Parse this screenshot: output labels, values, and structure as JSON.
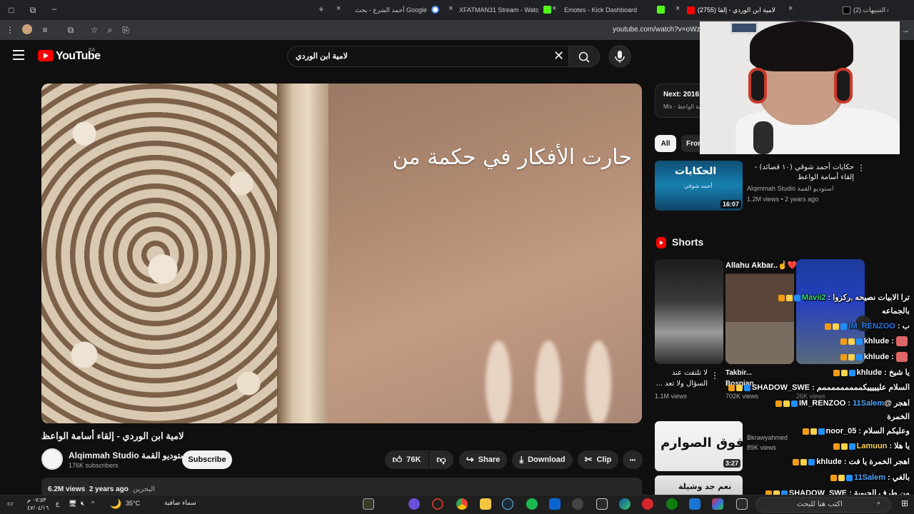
{
  "browser": {
    "tabs": [
      {
        "title": "(2) التنبيهات / X",
        "close": "×"
      },
      {
        "title": "(2755) لامية ابن الوردي - إلقا",
        "close": "×"
      },
      {
        "title": "Emotes - Kick Dashboard",
        "close": "×"
      },
      {
        "title": "XFATMAN31 Stream - Watch Li",
        "close": "×"
      },
      {
        "title": "أحمد الشرع - بحث Google",
        "close": "×"
      }
    ],
    "new_tab": "+",
    "url": "youtube.com/watch?v=oWzo"
  },
  "youtube": {
    "logo": "YouTube",
    "region": "SA",
    "search_value": "لامية ابن الوردي",
    "video": {
      "caption": "حارت الأفكار في حكمة من",
      "title": "لامية ابن الوردي - إلقاء أسامة الواعظ",
      "channel": "Alqimmah Studio استوديو القمة",
      "subscribers": "176K subscribers",
      "subscribe_label": "Subscribe",
      "likes": "76K",
      "share_label": "Share",
      "download_label": "Download",
      "clip_label": "Clip",
      "more_label": "•••",
      "views": "6.2M views",
      "age": "2 years ago",
      "location": "البحرين"
    },
    "upnext": {
      "label": "Next: 2016",
      "mix": "Mix - إلقاء أسامة الواعظ"
    },
    "chips": {
      "all": "All",
      "from": "From"
    },
    "rec1": {
      "thumb_title": "الحكايات",
      "thumb_sub": "أحمد شوقي",
      "duration": "16:07",
      "title": "حكايات أحمد شوقي (١٠ قصائد) - إلقاء أسامة الواعظ",
      "channel": "Alqimmah Studio استوديو القمة",
      "stats": "1.2M views • 2 years ago"
    },
    "shorts": {
      "label": "Shorts",
      "items": [
        {
          "title": "لا تلتفت عند السؤال ولا تعد ...",
          "views": "1.1M views"
        },
        {
          "overlay": "Allahu Akbar..☝️❤️",
          "title": "Takbir... Bosnian",
          "views": "702K views"
        },
        {
          "title": "",
          "views": "26K views"
        }
      ]
    },
    "rec2": {
      "thumb_title": "الهول فوق الصوارم",
      "duration": "3:27",
      "channel": "Bkrawyahmed",
      "views": "89K views"
    },
    "rec3": {
      "thumb_title": "نعم جد وشيلة"
    }
  },
  "chat": [
    {
      "user": "Mavii2",
      "color": "#3ddc84",
      "text": "ترا الابيات نصيحه ,ركزوا : "
    },
    {
      "user": "",
      "color": "#ffffff",
      "text": "بالجماعه"
    },
    {
      "user": "IM_RENZOO",
      "color": "#1f7ff0",
      "text": "ب : "
    },
    {
      "user": "khlude",
      "color": "#ffffff",
      "text": " : ",
      "emote": true
    },
    {
      "user": "khlude",
      "color": "#ffffff",
      "text": " : ",
      "emote": true
    },
    {
      "user": "khlude",
      "color": "#ffffff",
      "text": "يا شيخ : "
    },
    {
      "user": "SHADOW_SWE",
      "color": "#ffffff",
      "text": "السلام عليييييكمممممممممم : "
    },
    {
      "user": "11Salem",
      "color": "#4aa8ff",
      "text": "اهجر @IM_RENZOO : "
    },
    {
      "user": "",
      "color": "#ffffff",
      "text": "الخمرة"
    },
    {
      "user": "noor_05",
      "color": "#ffffff",
      "text": "وعليكم السلام : "
    },
    {
      "user": "Lamuun",
      "color": "#ffd84a",
      "text": "يا هلا : "
    },
    {
      "user": "khlude",
      "color": "#ffffff",
      "text": "اهجر الخمرة يا فت : "
    },
    {
      "user": "11Salem",
      "color": "#4aa8ff",
      "text": "بالغي : "
    },
    {
      "user": "SHADOW_SWE",
      "color": "#ffffff",
      "text": "من طرف الحبوبة : "
    },
    {
      "user": "@Lamuun",
      "color": "#ffffff",
      "text": ""
    }
  ],
  "taskbar": {
    "time": "٠٧:٥٣ م",
    "date": "٤٧/٠٤/١٦",
    "lang": "ع",
    "weather_temp": "35°C",
    "weather_desc": "سماء صافية",
    "search_placeholder": "اكتب هنا للبحث"
  }
}
